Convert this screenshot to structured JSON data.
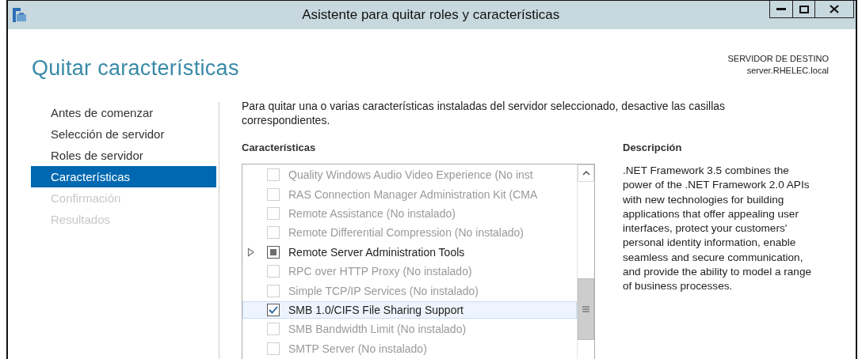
{
  "window": {
    "title": "Asistente para quitar roles y características"
  },
  "page": {
    "title": "Quitar características",
    "destination_label": "SERVIDOR DE DESTINO",
    "destination_server": "server.RHELEC.local"
  },
  "sidebar": {
    "items": [
      {
        "label": "Antes de comenzar",
        "selected": false,
        "disabled": false
      },
      {
        "label": "Selección de servidor",
        "selected": false,
        "disabled": false
      },
      {
        "label": "Roles de servidor",
        "selected": false,
        "disabled": false
      },
      {
        "label": "Características",
        "selected": true,
        "disabled": false
      },
      {
        "label": "Confirmación",
        "selected": false,
        "disabled": true
      },
      {
        "label": "Resultados",
        "selected": false,
        "disabled": true
      }
    ]
  },
  "instructions": "Para quitar una o varias características instaladas del servidor seleccionado, desactive las casillas correspondientes.",
  "features": {
    "heading": "Características",
    "items": [
      {
        "label": "Quality Windows Audio Video Experience (No inst",
        "checked": false,
        "partial": false,
        "disabled": true,
        "expandable": false,
        "selected": false
      },
      {
        "label": "RAS Connection Manager Administration Kit (CMA",
        "checked": false,
        "partial": false,
        "disabled": true,
        "expandable": false,
        "selected": false
      },
      {
        "label": "Remote Assistance (No instalado)",
        "checked": false,
        "partial": false,
        "disabled": true,
        "expandable": false,
        "selected": false
      },
      {
        "label": "Remote Differential Compression (No instalado)",
        "checked": false,
        "partial": false,
        "disabled": true,
        "expandable": false,
        "selected": false
      },
      {
        "label": "Remote Server Administration Tools",
        "checked": false,
        "partial": true,
        "disabled": false,
        "expandable": true,
        "expanded": false,
        "selected": false
      },
      {
        "label": "RPC over HTTP Proxy (No instalado)",
        "checked": false,
        "partial": false,
        "disabled": true,
        "expandable": false,
        "selected": false
      },
      {
        "label": "Simple TCP/IP Services (No instalado)",
        "checked": false,
        "partial": false,
        "disabled": true,
        "expandable": false,
        "selected": false
      },
      {
        "label": "SMB 1.0/CIFS File Sharing Support",
        "checked": true,
        "partial": false,
        "disabled": false,
        "expandable": false,
        "selected": true
      },
      {
        "label": "SMB Bandwidth Limit (No instalado)",
        "checked": false,
        "partial": false,
        "disabled": true,
        "expandable": false,
        "selected": false
      },
      {
        "label": "SMTP Server (No instalado)",
        "checked": false,
        "partial": false,
        "disabled": true,
        "expandable": false,
        "selected": false
      }
    ]
  },
  "description": {
    "heading": "Descripción",
    "text": ".NET Framework 3.5 combines the power of the .NET Framework 2.0 APIs with new technologies for building applications that offer appealing user interfaces, protect your customers' personal identity information, enable seamless and secure communication, and provide the ability to model a range of business processes."
  }
}
